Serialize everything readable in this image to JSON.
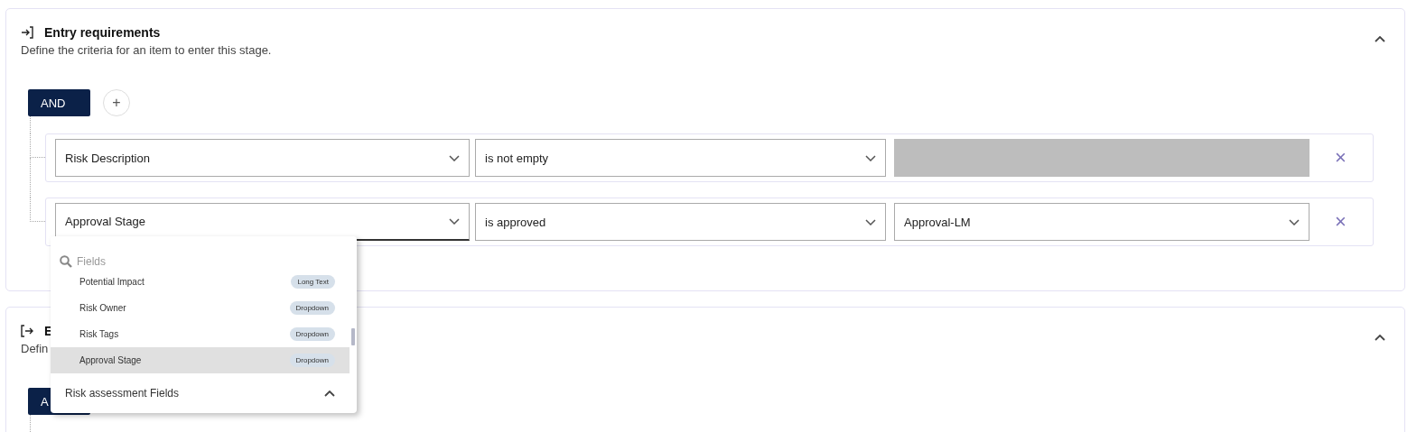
{
  "sections": [
    {
      "kind": "entry",
      "title": "Entry requirements",
      "description": "Define the criteria for an item to enter this stage.",
      "expanded": true,
      "operator": "AND",
      "add_label": "+",
      "conditions": [
        {
          "field": "Risk Description",
          "field_focused": false,
          "operator": "is not empty",
          "value_disabled": true,
          "remove": "×"
        },
        {
          "field": "Approval Stage",
          "field_focused": true,
          "operator": "is approved",
          "value": "Approval-LM",
          "value_disabled": false,
          "remove": "×"
        }
      ]
    },
    {
      "kind": "exit",
      "title": "E",
      "description": "Defin",
      "expanded": true,
      "operator": "A"
    }
  ],
  "dropdown": {
    "search": {
      "placeholder": "Fields"
    },
    "items": [
      {
        "label": "Potential Impact",
        "type": "Long Text",
        "selected": false
      },
      {
        "label": "Risk Owner",
        "type": "Dropdown",
        "selected": false
      },
      {
        "label": "Risk Tags",
        "type": "Dropdown",
        "selected": false
      },
      {
        "label": "Approval Stage",
        "type": "Dropdown",
        "selected": true
      }
    ],
    "group": {
      "label": "Risk assessment Fields",
      "expanded": true
    }
  }
}
